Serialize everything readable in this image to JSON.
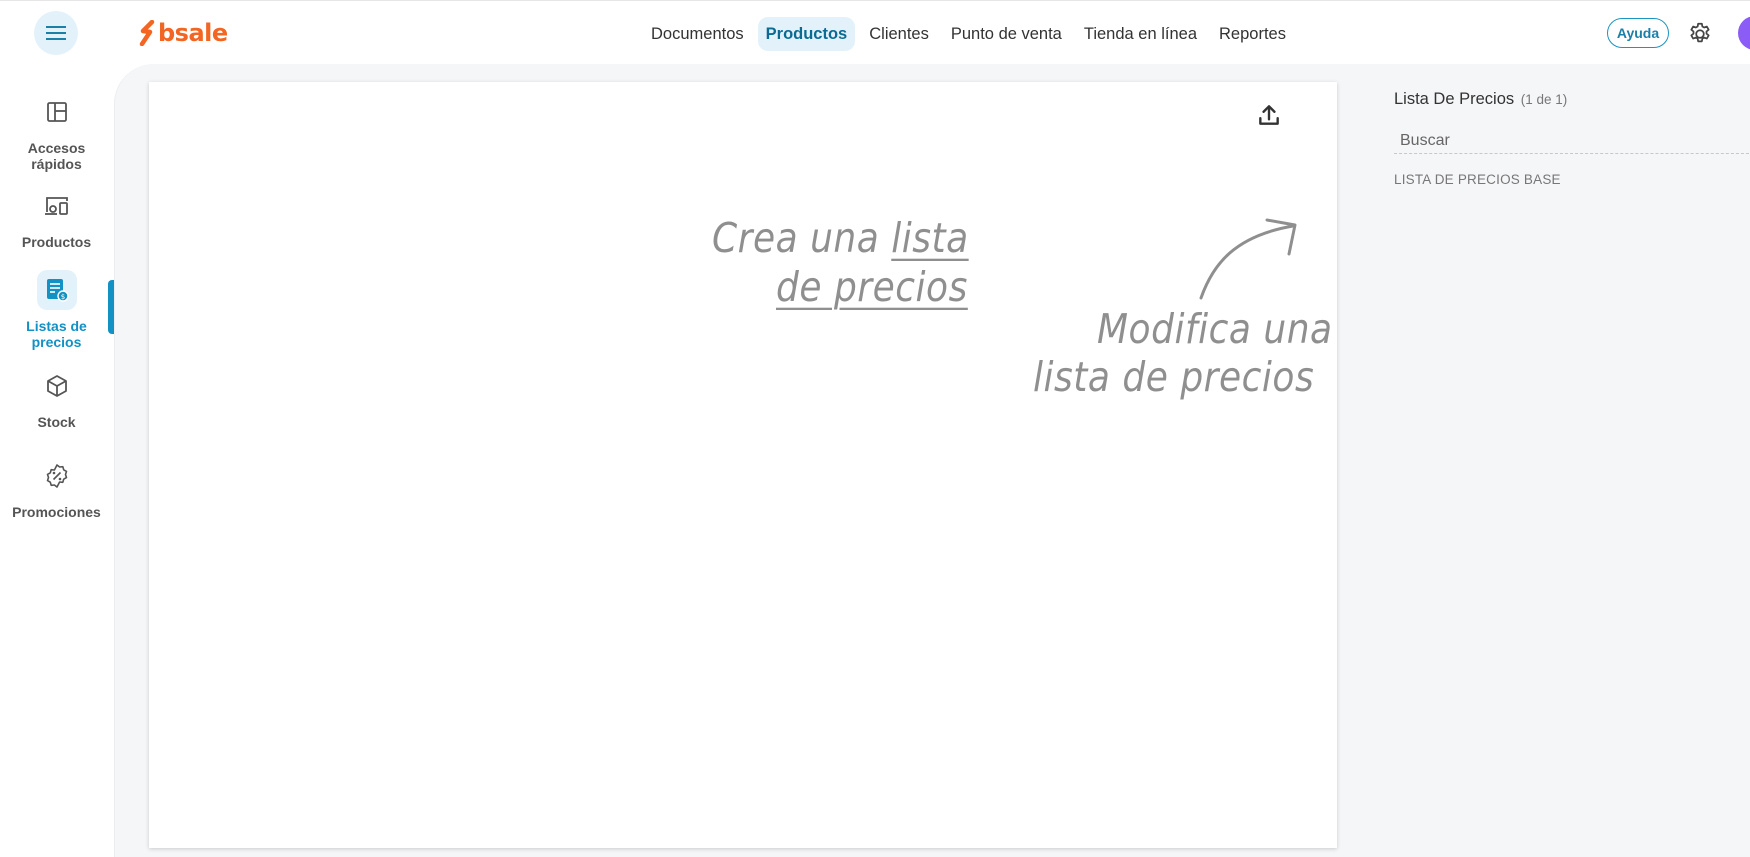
{
  "header": {
    "brand": "bsale",
    "nav": [
      "Documentos",
      "Productos",
      "Clientes",
      "Punto de venta",
      "Tienda en línea",
      "Reportes"
    ],
    "active_nav": "Productos",
    "help_label": "Ayuda",
    "icons": {
      "menu": "hamburger-menu-icon",
      "settings": "gear-icon",
      "avatar": "user-avatar"
    },
    "colors": {
      "brand": "#f26522",
      "accent": "#1291c4"
    }
  },
  "sidebar": {
    "items": [
      {
        "label": "Accesos rápidos",
        "icon": "dashboard-grid-icon"
      },
      {
        "label": "Productos",
        "icon": "devices-icon"
      },
      {
        "label": "Listas de precios",
        "icon": "price-list-icon"
      },
      {
        "label": "Stock",
        "icon": "box-icon"
      },
      {
        "label": "Promociones",
        "icon": "discount-badge-icon"
      }
    ],
    "active": "Listas de precios"
  },
  "main": {
    "hint_create": {
      "line1_prefix": "Crea una ",
      "line1_link": "lista",
      "line2_link": "de precios"
    },
    "hint_modify": {
      "line1": "Modifica una",
      "line2": "lista de precios"
    },
    "upload_icon": "upload-icon"
  },
  "right_panel": {
    "title": "Lista De Precios",
    "count": "(1 de 1)",
    "search_placeholder": "Buscar",
    "items": [
      "LISTA DE PRECIOS BASE"
    ]
  }
}
